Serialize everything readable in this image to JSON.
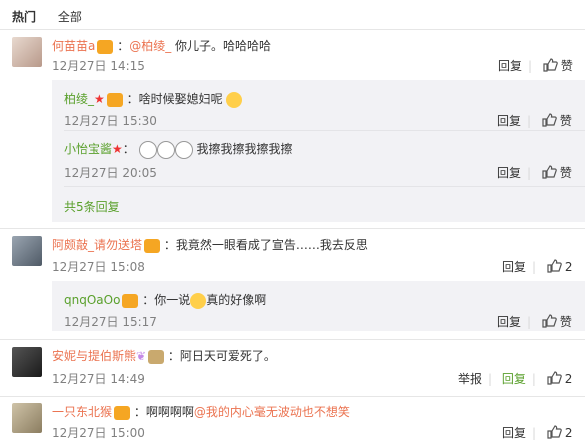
{
  "tabs": {
    "hot": "热门",
    "all": "全部"
  },
  "comments": [
    {
      "user": "何苗苗a",
      "mention": "@柏绫_",
      "text": "你儿子。哈哈哈哈",
      "time": "12月27日 14:15",
      "reply": "回复",
      "like": "赞",
      "replies": [
        {
          "user": "柏绫_",
          "text": "啥时候娶媳妇呢",
          "time": "12月27日 15:30",
          "reply": "回复",
          "like": "赞"
        },
        {
          "user": "小怡宝酱",
          "text": "我擦我擦我擦我擦",
          "time": "12月27日 20:05",
          "reply": "回复",
          "like": "赞"
        }
      ],
      "more": "共5条回复"
    },
    {
      "user": "阿颇敲_请勿送塔",
      "text": "我竟然一眼看成了宣告……我去反思",
      "time": "12月27日 15:08",
      "reply": "回复",
      "like": "2",
      "replies": [
        {
          "user": "qnqOaOo",
          "text_pre": "你一说",
          "text_post": "真的好像啊",
          "time": "12月27日 15:17",
          "reply": "回复",
          "like": "赞"
        }
      ]
    },
    {
      "user": "安妮与提伯斯熊",
      "text": "阿日天可爱死了。",
      "time": "12月27日 14:49",
      "report": "举报",
      "reply": "回复",
      "like": "2"
    },
    {
      "user": "一只东北猴",
      "text_pre": "啊啊啊啊",
      "mention": "@我的内心毫无波动也不想笑",
      "time": "12月27日 15:00",
      "reply": "回复",
      "like": "2"
    }
  ],
  "colors": {
    "name": "#eb7350",
    "green": "#5aa02c",
    "muted": "#808080",
    "replyBg": "#f2f2f5"
  }
}
